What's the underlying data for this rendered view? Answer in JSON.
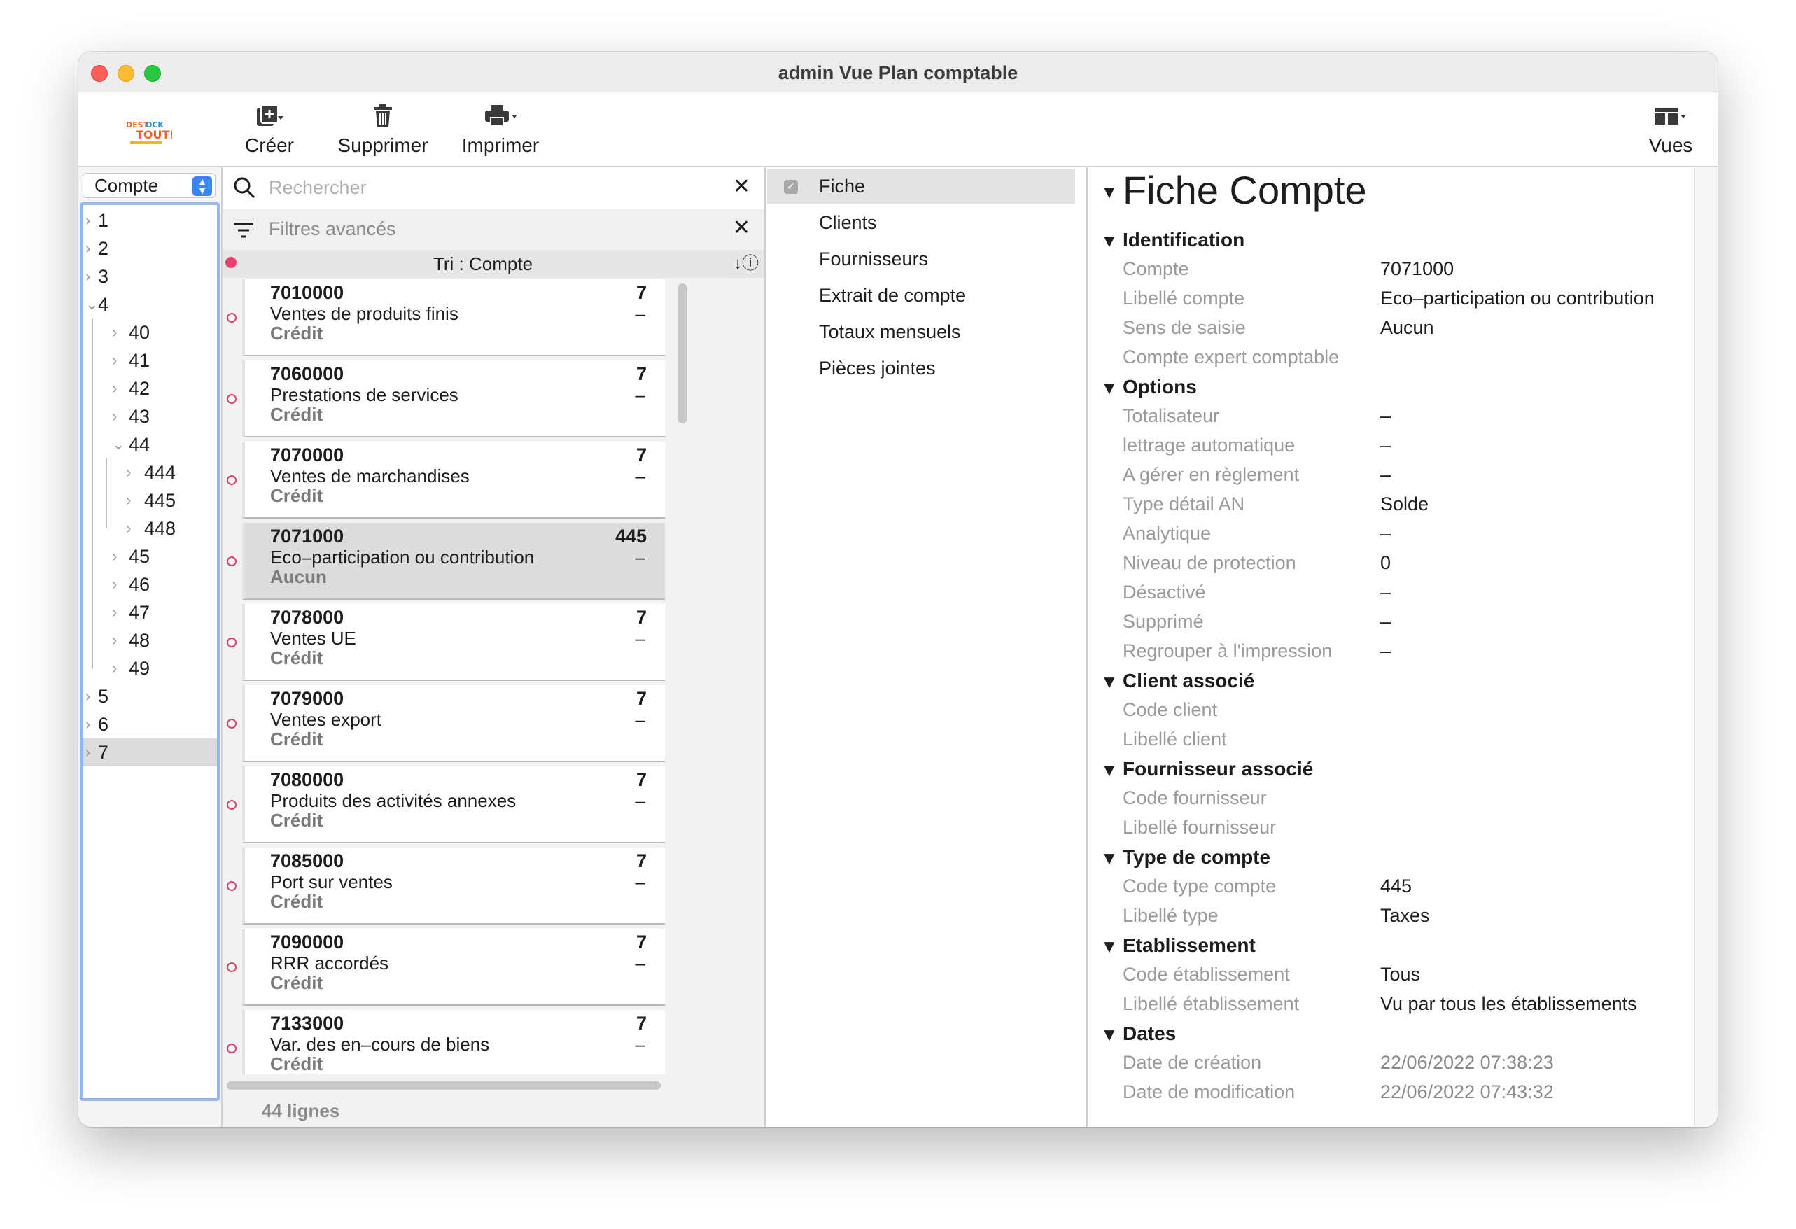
{
  "window": {
    "title": "admin Vue Plan comptable"
  },
  "toolbar": {
    "logo_icon": "destock-tout-logo",
    "creer_label": "Créer",
    "supprimer_label": "Supprimer",
    "imprimer_label": "Imprimer",
    "vues_label": "Vues"
  },
  "tree_pane": {
    "selector_value": "Compte",
    "nodes": [
      {
        "label": "1",
        "level": 0,
        "expanded": false
      },
      {
        "label": "2",
        "level": 0,
        "expanded": false
      },
      {
        "label": "3",
        "level": 0,
        "expanded": false
      },
      {
        "label": "4",
        "level": 0,
        "expanded": true
      },
      {
        "label": "40",
        "level": 1,
        "expanded": false
      },
      {
        "label": "41",
        "level": 1,
        "expanded": false
      },
      {
        "label": "42",
        "level": 1,
        "expanded": false
      },
      {
        "label": "43",
        "level": 1,
        "expanded": false
      },
      {
        "label": "44",
        "level": 1,
        "expanded": true
      },
      {
        "label": "444",
        "level": 2,
        "expanded": false
      },
      {
        "label": "445",
        "level": 2,
        "expanded": false
      },
      {
        "label": "448",
        "level": 2,
        "expanded": false
      },
      {
        "label": "45",
        "level": 1,
        "expanded": false
      },
      {
        "label": "46",
        "level": 1,
        "expanded": false
      },
      {
        "label": "47",
        "level": 1,
        "expanded": false
      },
      {
        "label": "48",
        "level": 1,
        "expanded": false
      },
      {
        "label": "49",
        "level": 1,
        "expanded": false
      },
      {
        "label": "5",
        "level": 0,
        "expanded": false
      },
      {
        "label": "6",
        "level": 0,
        "expanded": false
      },
      {
        "label": "7",
        "level": 0,
        "expanded": false,
        "selected": true
      }
    ]
  },
  "list_pane": {
    "search_placeholder": "Rechercher",
    "filters_placeholder": "Filtres avancés",
    "sort_label": "Tri : Compte",
    "footer": "44 lignes",
    "items": [
      {
        "code": "7010000",
        "libelle": "Ventes de produits finis",
        "sens": "Crédit",
        "num": "7",
        "extra": "–"
      },
      {
        "code": "7060000",
        "libelle": "Prestations de services",
        "sens": "Crédit",
        "num": "7",
        "extra": "–"
      },
      {
        "code": "7070000",
        "libelle": "Ventes de marchandises",
        "sens": "Crédit",
        "num": "7",
        "extra": "–"
      },
      {
        "code": "7071000",
        "libelle": "Eco–participation ou contribution",
        "sens": "Aucun",
        "num": "445",
        "extra": "–",
        "selected": true
      },
      {
        "code": "7078000",
        "libelle": "Ventes UE",
        "sens": "Crédit",
        "num": "7",
        "extra": "–"
      },
      {
        "code": "7079000",
        "libelle": "Ventes export",
        "sens": "Crédit",
        "num": "7",
        "extra": "–"
      },
      {
        "code": "7080000",
        "libelle": "Produits des activités annexes",
        "sens": "Crédit",
        "num": "7",
        "extra": "–"
      },
      {
        "code": "7085000",
        "libelle": "Port sur ventes",
        "sens": "Crédit",
        "num": "7",
        "extra": "–"
      },
      {
        "code": "7090000",
        "libelle": "RRR accordés",
        "sens": "Crédit",
        "num": "7",
        "extra": "–"
      },
      {
        "code": "7133000",
        "libelle": "Var. des en–cours de biens",
        "sens": "Crédit",
        "num": "7",
        "extra": "–"
      }
    ]
  },
  "nav_pane": {
    "items": [
      {
        "label": "Fiche",
        "selected": true
      },
      {
        "label": "Clients"
      },
      {
        "label": "Fournisseurs"
      },
      {
        "label": "Extrait de compte"
      },
      {
        "label": "Totaux mensuels"
      },
      {
        "label": "Pièces jointes"
      }
    ]
  },
  "detail": {
    "title": "Fiche Compte",
    "sections": [
      {
        "title": "Identification",
        "fields": [
          {
            "label": "Compte",
            "value": "7071000"
          },
          {
            "label": "Libellé compte",
            "value": "Eco–participation ou contribution"
          },
          {
            "label": "Sens de saisie",
            "value": "Aucun"
          },
          {
            "label": "Compte expert comptable",
            "value": ""
          }
        ]
      },
      {
        "title": "Options",
        "fields": [
          {
            "label": "Totalisateur",
            "value": "–"
          },
          {
            "label": "lettrage automatique",
            "value": "–"
          },
          {
            "label": "A gérer en règlement",
            "value": "–"
          },
          {
            "label": "Type détail AN",
            "value": "Solde"
          },
          {
            "label": "Analytique",
            "value": "–"
          },
          {
            "label": "Niveau de protection",
            "value": "0"
          },
          {
            "label": "Désactivé",
            "value": "–"
          },
          {
            "label": "Supprimé",
            "value": "–"
          },
          {
            "label": "Regrouper à l'impression",
            "value": "–"
          }
        ]
      },
      {
        "title": "Client associé",
        "fields": [
          {
            "label": "Code client",
            "value": ""
          },
          {
            "label": "Libellé client",
            "value": ""
          }
        ]
      },
      {
        "title": "Fournisseur associé",
        "fields": [
          {
            "label": "Code fournisseur",
            "value": ""
          },
          {
            "label": "Libellé fournisseur",
            "value": ""
          }
        ]
      },
      {
        "title": "Type de compte",
        "fields": [
          {
            "label": "Code type compte",
            "value": "445"
          },
          {
            "label": "Libellé type",
            "value": "Taxes"
          }
        ]
      },
      {
        "title": "Etablissement",
        "fields": [
          {
            "label": "Code établissement",
            "value": "Tous"
          },
          {
            "label": "Libellé établissement",
            "value": "Vu par tous les établissements"
          }
        ]
      },
      {
        "title": "Dates",
        "fields": [
          {
            "label": "Date de création",
            "value": "22/06/2022 07:38:23",
            "muted": true
          },
          {
            "label": "Date de modification",
            "value": "22/06/2022 07:43:32",
            "muted": true
          }
        ]
      }
    ]
  }
}
